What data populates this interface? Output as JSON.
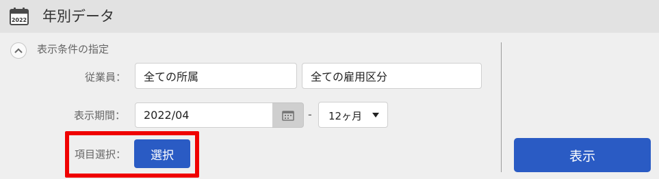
{
  "header": {
    "icon": "calendar-icon",
    "icon_year": "2022",
    "title": "年別データ"
  },
  "section": {
    "toggle_icon": "chevron-up-icon",
    "label": "表示条件の指定"
  },
  "employee": {
    "label": "従業員：",
    "department_value": "全ての所属",
    "employment_type_value": "全ての雇用区分"
  },
  "period": {
    "label": "表示期間：",
    "start_value": "2022/04",
    "date_picker_icon": "calendar-picker-icon",
    "separator": "-",
    "duration_selected": "12ヶ月"
  },
  "items": {
    "label": "項目選択：",
    "select_button": "選択"
  },
  "actions": {
    "show_button": "表示"
  },
  "colors": {
    "primary": "#2a5bc4",
    "highlight": "#ef0000",
    "header_bg": "#e2e2e2",
    "page_bg": "#efefef"
  }
}
